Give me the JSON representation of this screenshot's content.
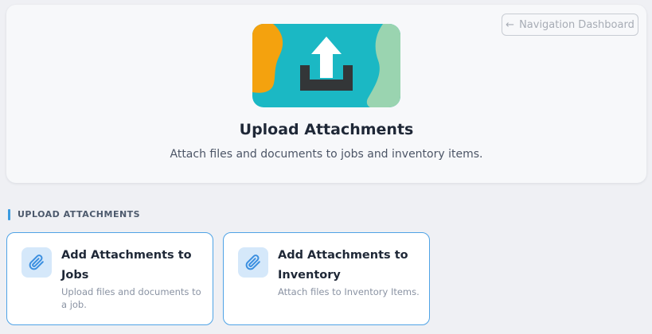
{
  "nav_button": {
    "label": "Navigation Dashboard",
    "icon": "arrow-left-icon"
  },
  "hero": {
    "title": "Upload Attachments",
    "subtitle": "Attach files and documents to jobs and inventory items.",
    "colors": {
      "teal": "#1bb8c4",
      "orange": "#f4a20e",
      "green": "#9ad4b0",
      "tray": "#333638",
      "arrow": "#ffffff"
    }
  },
  "section": {
    "label": "UPLOAD ATTACHMENTS",
    "accent": "#3b9be0"
  },
  "cards": [
    {
      "title": "Add Attachments to Jobs",
      "description": "Upload files and documents to a job.",
      "icon": "paperclip-icon"
    },
    {
      "title": "Add Attachments to Inventory",
      "description": "Attach files to Inventory Items.",
      "icon": "paperclip-icon"
    }
  ]
}
